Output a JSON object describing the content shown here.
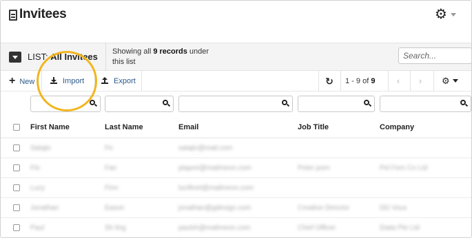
{
  "header": {
    "title": "Invitees",
    "settings_icon": "gear-icon"
  },
  "listbar": {
    "list_prefix": "LIST:",
    "list_name": "All Invitees",
    "showing_prefix": "Showing all",
    "showing_count": "9 records",
    "showing_suffix": "under this list",
    "search_placeholder": "Search..."
  },
  "actions": {
    "new_label": "New",
    "import_label": "Import",
    "export_label": "Export",
    "refresh_icon": "refresh-icon",
    "pager_range": "1 - 9",
    "pager_of": "of",
    "pager_total": "9",
    "prev_icon": "chevron-left-icon",
    "next_icon": "chevron-right-icon",
    "columns_icon": "gear-icon"
  },
  "table": {
    "columns": [
      "First Name",
      "Last Name",
      "Email",
      "Job Title",
      "Company"
    ],
    "rows": [
      [
        "Satajiv",
        "Fe",
        "satajiv@mail.com",
        "",
        ""
      ],
      [
        "Flo",
        "Fan",
        "piaport@mailmeon.com",
        "Peter porn",
        "Pel Fem Co Ltd"
      ],
      [
        "Lucy",
        "Finn",
        "lucifinet@mailmeon.com",
        "",
        ""
      ],
      [
        "Jonathan",
        "Eason",
        "jonathan@gdesign.com",
        "Creative Director",
        "DD Vous"
      ],
      [
        "Paul",
        "Sh ling",
        "paulsh@mailmeon.com",
        "Chief Officer",
        "Diata Pte Ltd"
      ]
    ]
  },
  "colors": {
    "accent": "#2a5a8a",
    "highlight": "#f2b51d"
  }
}
